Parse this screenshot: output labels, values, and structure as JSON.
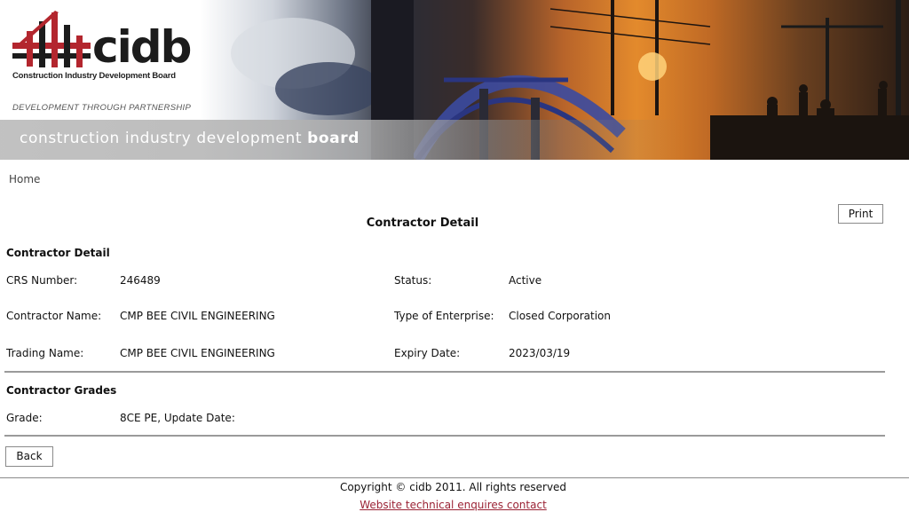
{
  "header": {
    "logo_text": "cidb",
    "logo_subtitle": "Construction Industry Development Board",
    "tagline": "DEVELOPMENT THROUGH PARTNERSHIP",
    "banner_title_light": "construction industry development ",
    "banner_title_bold": "board"
  },
  "breadcrumb": {
    "home": "Home"
  },
  "page": {
    "title": "Contractor Detail",
    "print_label": "Print"
  },
  "contractor_detail": {
    "heading": "Contractor Detail",
    "crs_label": "CRS Number:",
    "crs_value": "246489",
    "status_label": "Status:",
    "status_value": "Active",
    "name_label": "Contractor Name:",
    "name_value": "CMP BEE CIVIL ENGINEERING",
    "enterprise_label": "Type of Enterprise:",
    "enterprise_value": "Closed Corporation",
    "trading_label": "Trading Name:",
    "trading_value": "CMP BEE CIVIL ENGINEERING",
    "expiry_label": "Expiry Date:",
    "expiry_value": "2023/03/19"
  },
  "contractor_grades": {
    "heading": "Contractor Grades",
    "grade_label": "Grade:",
    "grade_value": "8CE PE, Update Date:"
  },
  "actions": {
    "back_label": "Back"
  },
  "footer": {
    "copyright": "Copyright © cidb 2011. All rights reserved",
    "contact_link": "Website technical enquires contact"
  },
  "colors": {
    "brand_red": "#b3262e",
    "link_red": "#9b2335",
    "divider_gray": "#9a9a9a"
  }
}
